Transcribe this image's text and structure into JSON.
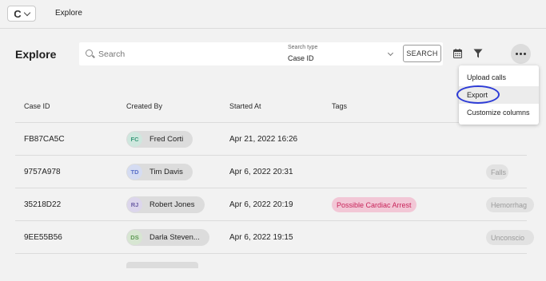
{
  "topbar": {
    "logo_glyph": "C",
    "title": "Explore"
  },
  "header": {
    "title": "Explore",
    "search": {
      "placeholder": "Search",
      "type_label": "Search type",
      "type_value": "Case ID",
      "button_label": "SEARCH"
    }
  },
  "more_menu": {
    "items": [
      {
        "label": "Upload calls",
        "selected": false
      },
      {
        "label": "Export",
        "selected": true
      },
      {
        "label": "Customize columns",
        "selected": false
      }
    ]
  },
  "table": {
    "columns": [
      "Case ID",
      "Created By",
      "Started At",
      "Tags"
    ],
    "rows": [
      {
        "case_id": "FB87CA5C",
        "initials": "FC",
        "name": "Fred Corti",
        "avatar_bg": "#cfe7de",
        "avatar_fg": "#3a9b7a",
        "started": "Apr 21, 2022 16:26",
        "tags": []
      },
      {
        "case_id": "9757A978",
        "initials": "TD",
        "name": "Tim Davis",
        "avatar_bg": "#d5dcf2",
        "avatar_fg": "#5a70c8",
        "started": "Apr 6, 2022 20:31",
        "tags": [
          "Falls"
        ]
      },
      {
        "case_id": "35218D22",
        "initials": "RJ",
        "name": "Robert Jones",
        "avatar_bg": "#dcd6ec",
        "avatar_fg": "#6d5fa6",
        "started": "Apr 6, 2022 20:19",
        "tags": [
          "Possible Cardiac Arrest",
          "Hemorrhag"
        ]
      },
      {
        "case_id": "9EE55B56",
        "initials": "DS",
        "name": "Darla Steven...",
        "avatar_bg": "#d7e6d2",
        "avatar_fg": "#5f9a55",
        "started": "Apr 6, 2022 19:15",
        "tags": [
          "Unconscio"
        ]
      }
    ]
  },
  "colors": {
    "accent_ring": "#2d3bd6",
    "cardiac_tag_bg": "#f2c7d6",
    "cardiac_tag_fg": "#c8245a"
  }
}
